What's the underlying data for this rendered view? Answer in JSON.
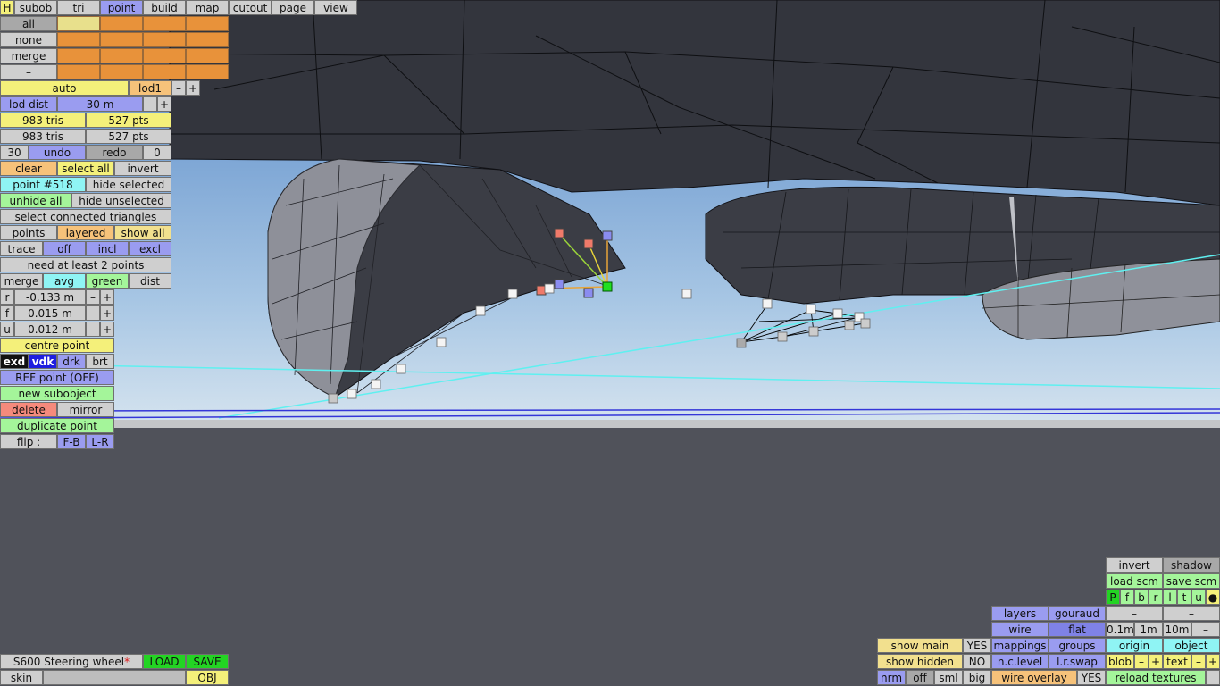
{
  "top_tabs": [
    "H",
    "subob",
    "tri",
    "point",
    "build",
    "map",
    "cutout",
    "page",
    "view"
  ],
  "sel_rows": [
    "all",
    "none",
    "merge",
    "–"
  ],
  "lod": {
    "mode": "auto",
    "level": "lod1",
    "minus": "–",
    "plus": "+"
  },
  "lod_dist": {
    "label": "lod dist",
    "value": "30 m",
    "minus": "–",
    "plus": "+"
  },
  "counts": {
    "tris1": "983 tris",
    "pts1": "527 pts",
    "tris2": "983 tris",
    "pts2": "527 pts"
  },
  "undo": {
    "count": "30",
    "undo": "undo",
    "redo": "redo",
    "redo_count": "0"
  },
  "sel": {
    "clear": "clear",
    "select_all": "select all",
    "invert": "invert"
  },
  "point": {
    "label": "point #518",
    "hide_selected": "hide selected"
  },
  "hide": {
    "unhide_all": "unhide all",
    "hide_unselected": "hide unselected"
  },
  "select_connected": "select connected triangles",
  "view_opts": {
    "points": "points",
    "layered": "layered",
    "show_all": "show all"
  },
  "trace": {
    "label": "trace",
    "off": "off",
    "incl": "incl",
    "excl": "excl"
  },
  "status": "need at least 2 points",
  "merge_row": {
    "merge": "merge",
    "avg": "avg",
    "green": "green",
    "dist": "dist"
  },
  "coords": [
    {
      "axis": "r",
      "value": "-0.133 m",
      "minus": "–",
      "plus": "+"
    },
    {
      "axis": "f",
      "value": "0.015 m",
      "minus": "–",
      "plus": "+"
    },
    {
      "axis": "u",
      "value": "0.012 m",
      "minus": "–",
      "plus": "+"
    }
  ],
  "centre_point": "centre point",
  "shade": {
    "exd": "exd",
    "vdk": "vdk",
    "drk": "drk",
    "brt": "brt"
  },
  "ref_point": "REF point (OFF)",
  "new_subobject": "new subobject",
  "delete_row": {
    "delete": "delete",
    "mirror": "mirror"
  },
  "duplicate_point": "duplicate point",
  "flip": {
    "label": "flip :",
    "fb": "F-B",
    "lr": "L-R"
  },
  "file": {
    "name": "S600 Steering wheel",
    "star": "*",
    "load": "LOAD",
    "save": "SAVE",
    "skin": "skin",
    "obj": "OBJ"
  },
  "right_panel": {
    "invert": "invert",
    "shadow": "shadow",
    "load_scm": "load scm",
    "save_scm": "save scm",
    "letters": [
      "P",
      "f",
      "b",
      "r",
      "l",
      "t",
      "u",
      "●"
    ],
    "dash": "–",
    "layers": "layers",
    "gouraud": "gouraud",
    "wire": "wire",
    "flat": "flat",
    "g01": "0.1m",
    "g1": "1m",
    "g10": "10m",
    "mappings": "mappings",
    "groups": "groups",
    "origin": "origin",
    "object": "object",
    "nclevel": "n.c.level",
    "lrswap": "l.r.swap",
    "blob": "blob",
    "text": "text",
    "minus": "–",
    "plus": "+",
    "nrm": "nrm",
    "off": "off",
    "sml": "sml",
    "big": "big",
    "wire_overlay": "wire overlay",
    "reload_textures": "reload textures",
    "show_main": "show main",
    "show_main_val": "YES",
    "show_hidden": "show hidden",
    "show_hidden_val": "NO",
    "wire_overlay_val": "YES"
  },
  "colors": {
    "sky": "#9fc6e6",
    "ground": "#50525a",
    "mesh_dark": "#33353d",
    "mesh_light": "#9a9da6",
    "cyan_line": "#5ff0f0",
    "blue_line": "#3436d8"
  }
}
